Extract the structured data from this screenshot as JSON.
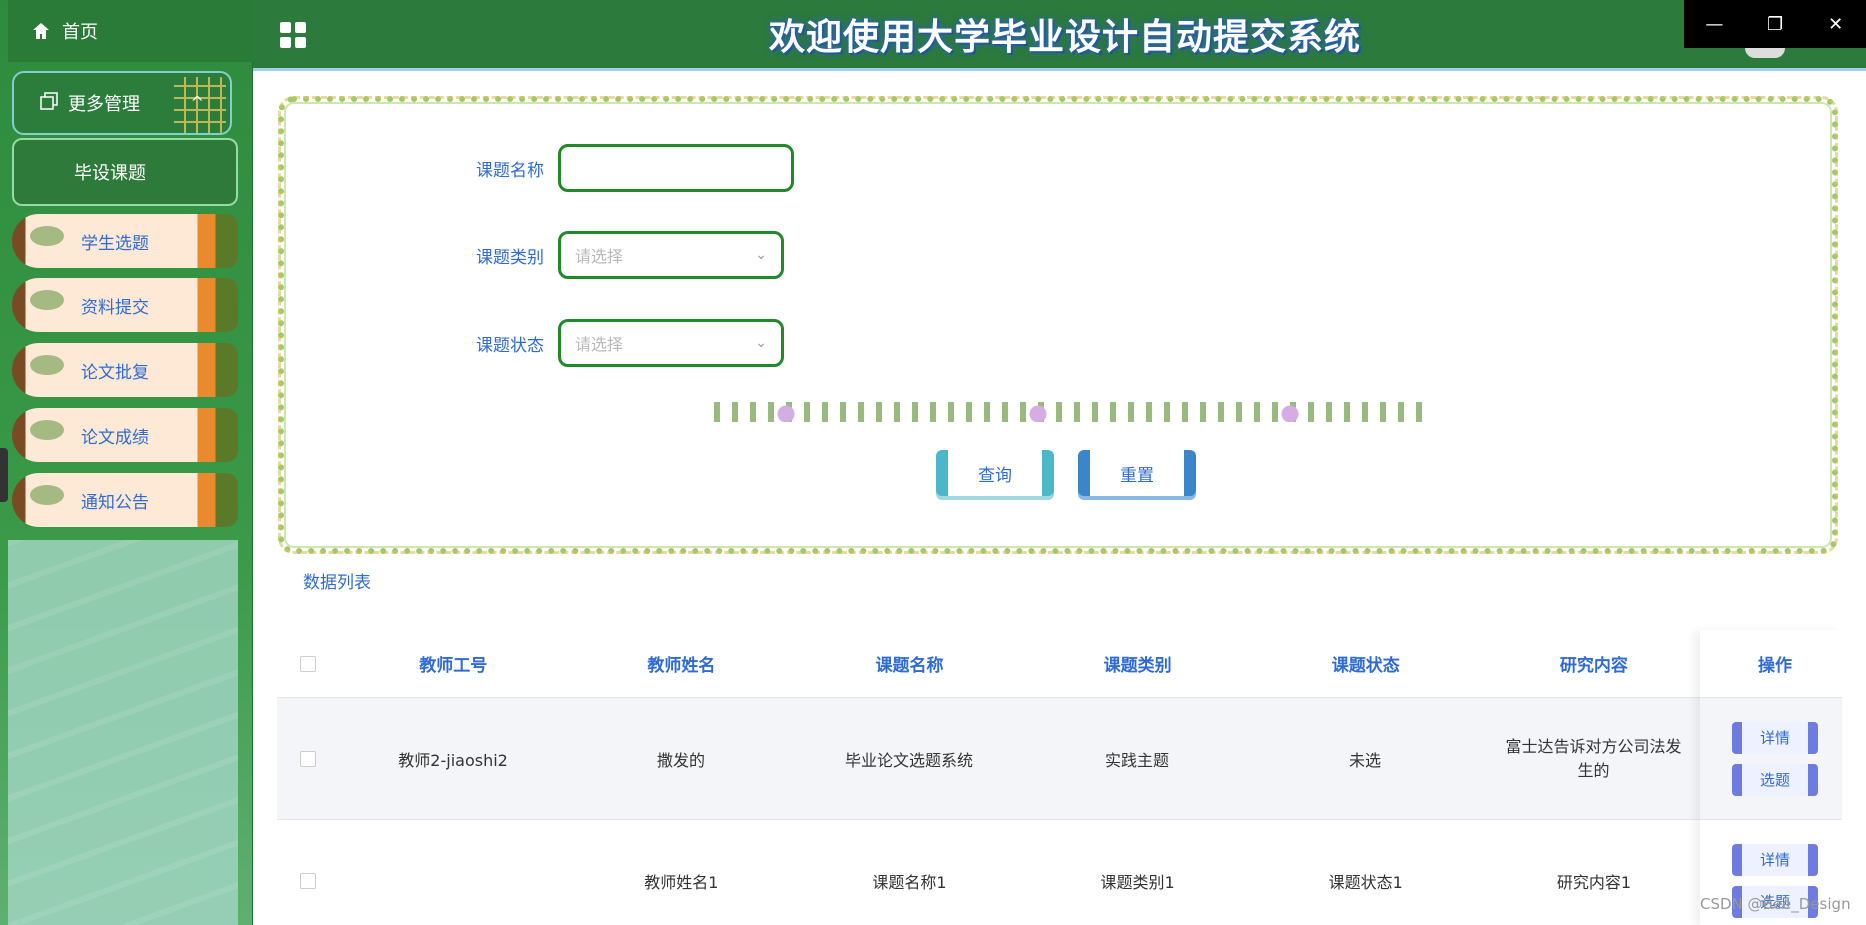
{
  "sidebar": {
    "home_label": "首页",
    "more_label": "更多管理",
    "active_item": "毕设课题",
    "items": [
      "学生选题",
      "资料提交",
      "论文批复",
      "论文成绩",
      "通知公告"
    ]
  },
  "header": {
    "title": "欢迎使用大学毕业设计自动提交系统"
  },
  "search": {
    "name_label": "课题名称",
    "name_value": "",
    "type_label": "课题类别",
    "type_placeholder": "请选择",
    "status_label": "课题状态",
    "status_placeholder": "请选择",
    "query_label": "查询",
    "reset_label": "重置"
  },
  "list": {
    "title": "数据列表",
    "columns": [
      "教师工号",
      "教师姓名",
      "课题名称",
      "课题类别",
      "课题状态",
      "研究内容",
      "操作"
    ],
    "rows": [
      {
        "teacher_id": "教师2-jiaoshi2",
        "teacher_name": "撒发的",
        "topic_name": "毕业论文选题系统",
        "topic_type": "实践主题",
        "topic_status": "未选",
        "research": "富士达告诉对方公司法发生的",
        "detail": "详情",
        "select": "选题"
      },
      {
        "teacher_id": "",
        "teacher_name": "教师姓名1",
        "topic_name": "课题名称1",
        "topic_type": "课题类别1",
        "topic_status": "课题状态1",
        "research": "研究内容1",
        "detail": "详情",
        "select": "选题"
      }
    ]
  },
  "watermark": "CSDN @Bee_Design",
  "colors": {
    "sidebar": "#2e8b3e",
    "header": "#2c7a3c",
    "accent": "#2f6bd6",
    "input_border": "#1f8a2a"
  }
}
